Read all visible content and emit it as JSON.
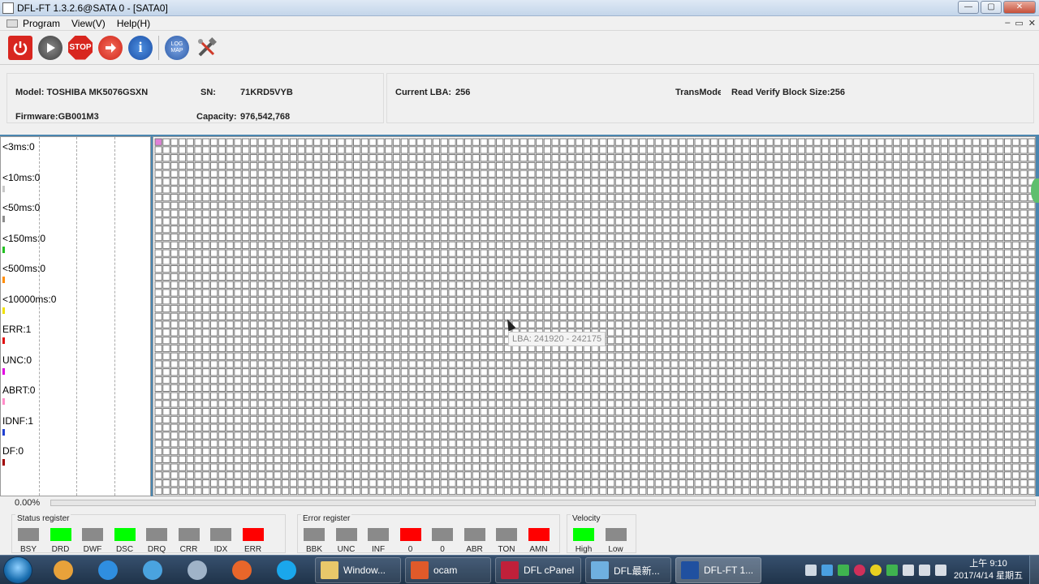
{
  "window": {
    "title": "DFL-FT 1.3.2.6@SATA 0 - [SATA0]",
    "minimize": "—",
    "maximize": "▢",
    "close": "✕"
  },
  "menu": {
    "items": [
      "Program",
      "View(V)",
      "Help(H)"
    ],
    "mdi_minimize": "–",
    "mdi_restore": "▭",
    "mdi_close": "✕"
  },
  "toolbar": {
    "stop_label": "STOP",
    "info_label": "i",
    "logmap_label": "LOG MAP"
  },
  "device": {
    "model_label": "Model: TOSHIBA MK5076GSXN",
    "sn_label": "SN:",
    "sn_value": "71KRD5VYB",
    "firmware_label": "Firmware:GB001M3",
    "capacity_label": "Capacity:",
    "capacity_value": "976,542,768",
    "current_lba_label": "Current LBA:",
    "current_lba_value": "256",
    "transmode_label": "TransMode",
    "read_mode": "Read Verify Block Size:256"
  },
  "stats": [
    {
      "label": "<3ms:0",
      "color": "#ffffff"
    },
    {
      "label": "<10ms:0",
      "color": "#c8c8c8"
    },
    {
      "label": "<50ms:0",
      "color": "#8c8c8c"
    },
    {
      "label": "<150ms:0",
      "color": "#22c022"
    },
    {
      "label": "<500ms:0",
      "color": "#ff8c00"
    },
    {
      "label": "<10000ms:0",
      "color": "#f0e000"
    },
    {
      "label": "ERR:1",
      "color": "#e01010"
    },
    {
      "label": "UNC:0",
      "color": "#e000e0"
    },
    {
      "label": "ABRT:0",
      "color": "#ff8cc8"
    },
    {
      "label": "IDNF:1",
      "color": "#2040d0"
    },
    {
      "label": "DF:0",
      "color": "#a00000"
    }
  ],
  "grid": {
    "colors": {
      "empty": "#ffffff",
      "border": "#7a7a7a",
      "first_block": "#e080d8"
    }
  },
  "tooltip": {
    "text": "LBA:  241920 - 242175"
  },
  "progress": {
    "label": "0.00%",
    "value": 0.0
  },
  "status_register": {
    "title": "Status register",
    "bits": [
      {
        "label": "BSY",
        "color": "#8a8a8a"
      },
      {
        "label": "DRD",
        "color": "#00ff00"
      },
      {
        "label": "DWF",
        "color": "#8a8a8a"
      },
      {
        "label": "DSC",
        "color": "#00ff00"
      },
      {
        "label": "DRQ",
        "color": "#8a8a8a"
      },
      {
        "label": "CRR",
        "color": "#8a8a8a"
      },
      {
        "label": "IDX",
        "color": "#8a8a8a"
      },
      {
        "label": "ERR",
        "color": "#ff0000"
      }
    ]
  },
  "error_register": {
    "title": "Error register",
    "bits": [
      {
        "label": "BBK",
        "color": "#8a8a8a"
      },
      {
        "label": "UNC",
        "color": "#8a8a8a"
      },
      {
        "label": "INF",
        "color": "#8a8a8a"
      },
      {
        "label": "0",
        "color": "#ff0000"
      },
      {
        "label": "0",
        "color": "#8a8a8a"
      },
      {
        "label": "ABR",
        "color": "#8a8a8a"
      },
      {
        "label": "TON",
        "color": "#8a8a8a"
      },
      {
        "label": "AMN",
        "color": "#ff0000"
      }
    ]
  },
  "velocity": {
    "title": "Velocity",
    "bits": [
      {
        "label": "High",
        "color": "#00ff00"
      },
      {
        "label": "Low",
        "color": "#8a8a8a"
      }
    ]
  },
  "taskbar": {
    "pinned": [
      {
        "name": "photo-viewer-icon",
        "color": "#e8a23a"
      },
      {
        "name": "ie-icon",
        "color": "#2f8ee0"
      },
      {
        "name": "network-icon",
        "color": "#4aa3df"
      },
      {
        "name": "mail-icon",
        "color": "#9fb3c8"
      },
      {
        "name": "firefox-icon",
        "color": "#e8662a"
      },
      {
        "name": "skype-icon",
        "color": "#1aa7ec"
      }
    ],
    "tasks": [
      {
        "label": "Window...",
        "icon_color": "#e8c86a",
        "active": false
      },
      {
        "label": "ocam",
        "icon_color": "#e05a2a",
        "active": false
      },
      {
        "label": "DFL cPanel",
        "icon_color": "#c0203a",
        "active": false
      },
      {
        "label": "DFL最新...",
        "icon_color": "#6fb0e0",
        "active": false
      },
      {
        "label": "DFL-FT 1...",
        "icon_color": "#2050a0",
        "active": true
      }
    ],
    "time": "上午 9:10",
    "date": "2017/4/14 星期五"
  }
}
